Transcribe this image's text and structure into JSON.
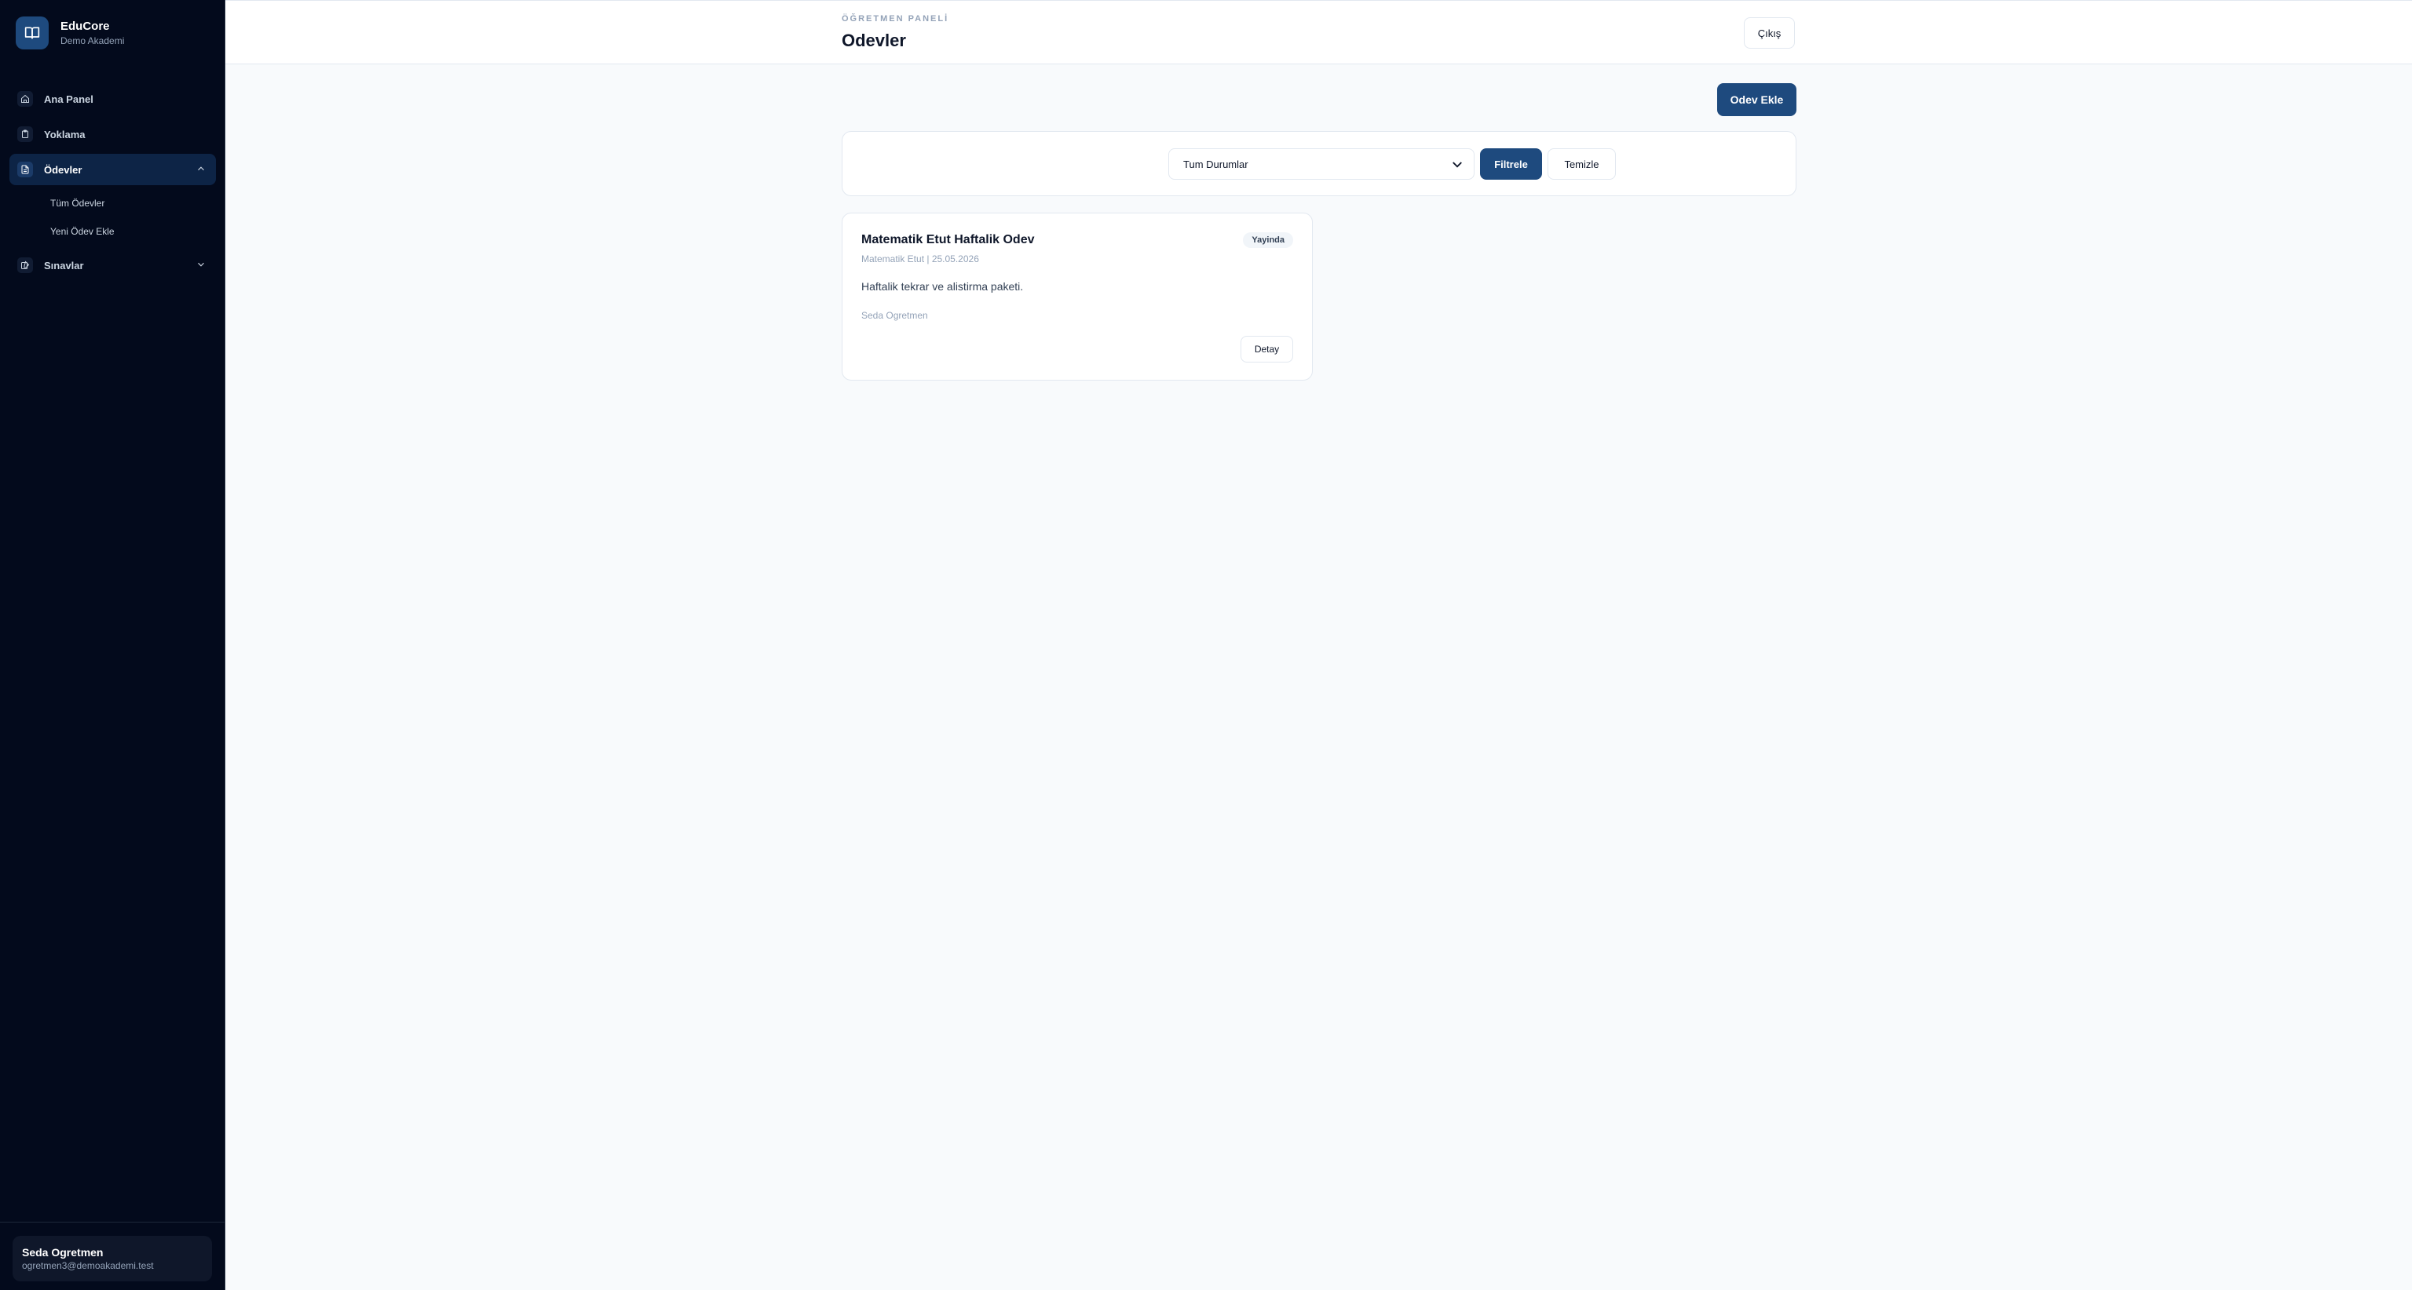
{
  "brand": {
    "name": "EduCore",
    "subtitle": "Demo Akademi",
    "icon": "book-open-icon"
  },
  "sidebar": {
    "items": [
      {
        "label": "Ana Panel",
        "icon": "home-icon"
      },
      {
        "label": "Yoklama",
        "icon": "clipboard-icon"
      },
      {
        "label": "Ödevler",
        "icon": "file-icon",
        "expanded": true,
        "children": [
          {
            "label": "Tüm Ödevler"
          },
          {
            "label": "Yeni Ödev Ekle"
          }
        ]
      },
      {
        "label": "Sınavlar",
        "icon": "edit-icon",
        "expanded": false
      }
    ]
  },
  "user": {
    "name": "Seda Ogretmen",
    "email": "ogretmen3@demoakademi.test"
  },
  "header": {
    "eyebrow": "ÖĞRETMEN PANELİ",
    "title": "Odevler",
    "logout_label": "Çıkış"
  },
  "actions": {
    "add_label": "Odev Ekle"
  },
  "filters": {
    "status_selected": "Tum Durumlar",
    "filter_label": "Filtrele",
    "clear_label": "Temizle"
  },
  "assignments": [
    {
      "title": "Matematik Etut Haftalik Odev",
      "meta": "Matematik Etut | 25.05.2026",
      "status": "Yayinda",
      "description": "Haftalik tekrar ve alistirma paketi.",
      "author": "Seda Ogretmen",
      "detail_label": "Detay"
    }
  ],
  "colors": {
    "sidebar_bg": "#030a1c",
    "accent": "#1e4a7e",
    "page_bg": "#f8fafc"
  }
}
